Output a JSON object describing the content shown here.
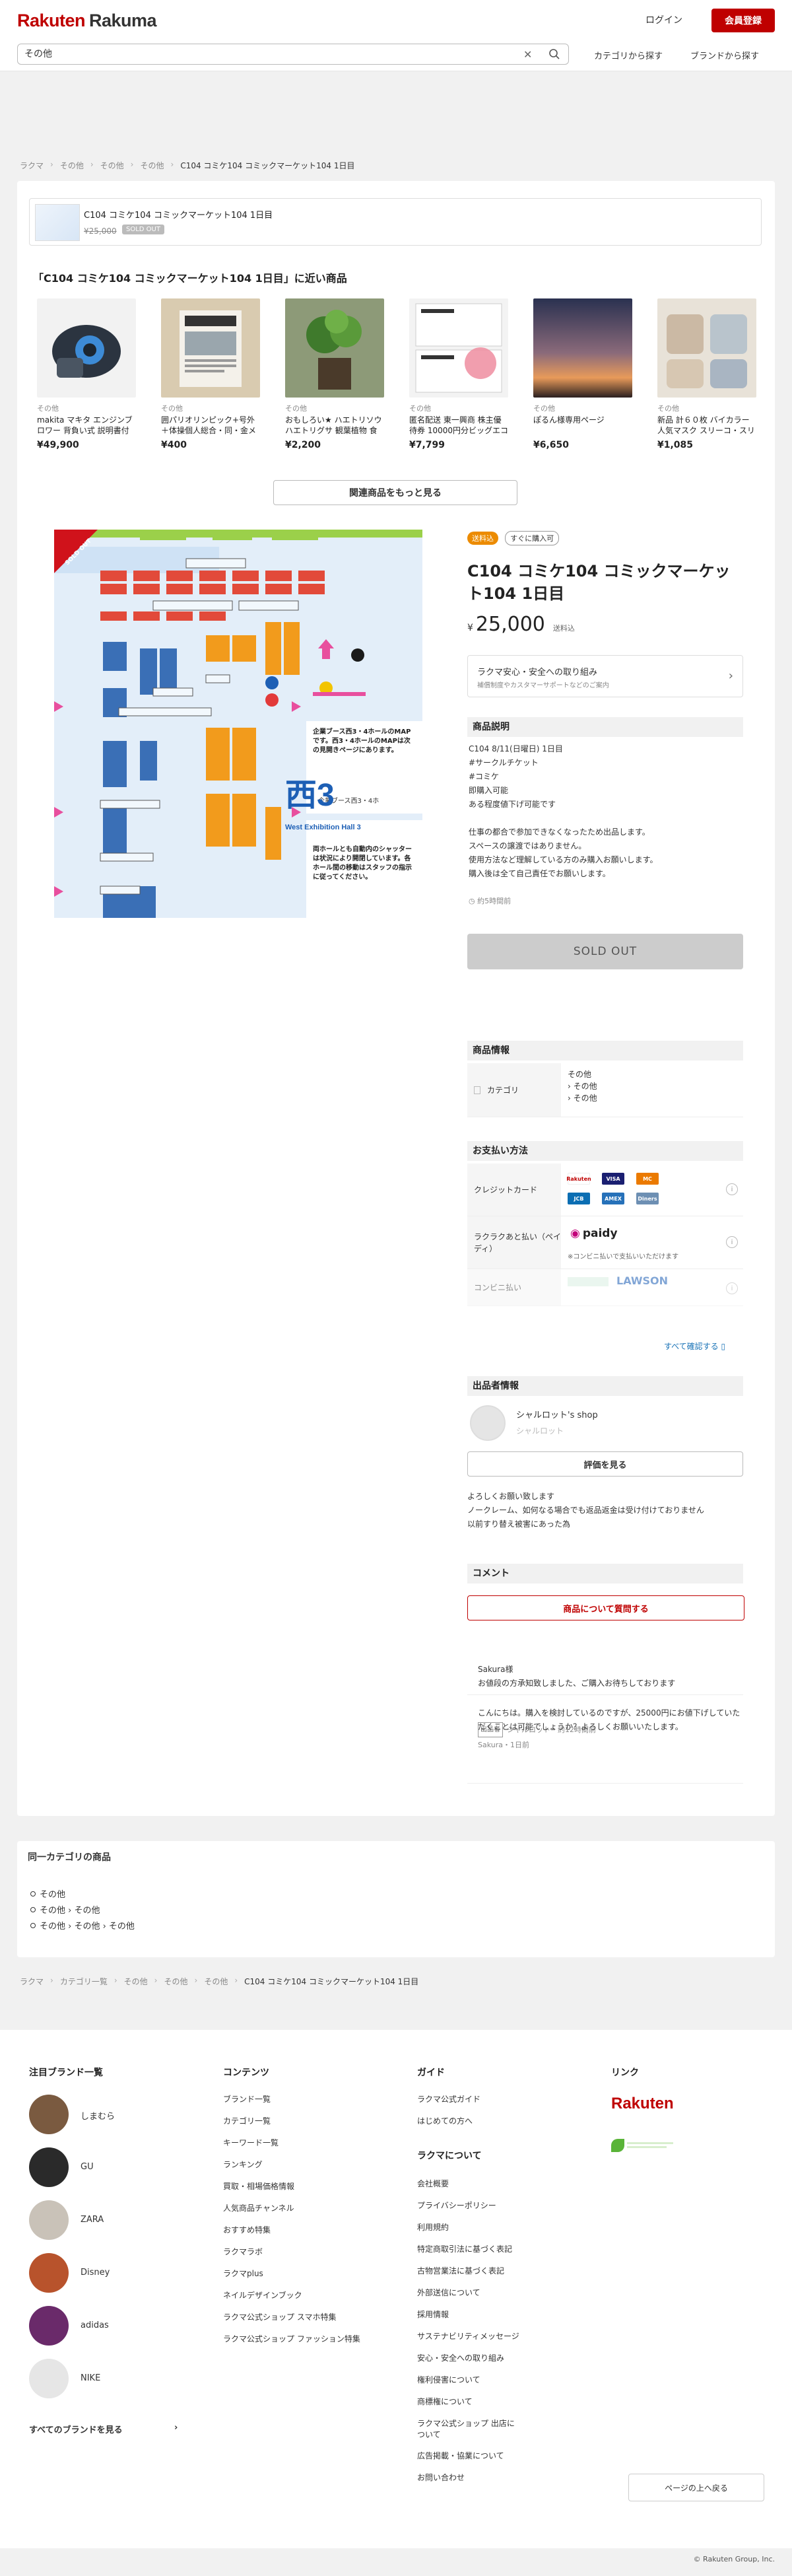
{
  "header": {
    "logo_a": "Rakuten",
    "logo_b": "Rakuma",
    "login": "ログイン",
    "signup": "会員登録",
    "search_value": "その他",
    "category_search": "カテゴリから探す",
    "brand_search": "ブランドから探す"
  },
  "breadcrumb_top": [
    "ラクマ",
    "その他",
    "その他",
    "その他",
    "C104 コミケ104 コミックマーケット104 1日目"
  ],
  "pinned": {
    "title": "C104 コミケ104 コミックマーケット104 1日目",
    "price": "¥25,000",
    "badge": "SOLD OUT"
  },
  "similar": {
    "title": "「C104 コミケ104 コミックマーケット104 1日目」に近い商品",
    "items": [
      {
        "cat": "その他",
        "name": "makita マキタ エンジンブロワー 背負い式 説明書付き 引取…",
        "price": "¥49,900"
      },
      {
        "cat": "その他",
        "name": "囲パリオリンピック+号外＋体操個人総合・同・金メダル囲",
        "price": "¥400"
      },
      {
        "cat": "その他",
        "name": "おもしろい★ ハエトリソウ ハエトリグサ 観葉植物 食虫植物",
        "price": "¥2,200"
      },
      {
        "cat": "その他",
        "name": "匿名配送 東一興商 株主優待券 10000円分ビッグエコー 1万円",
        "price": "¥7,799"
      },
      {
        "cat": "その他",
        "name": "ぽるん様専用ページ",
        "price": "¥6,650"
      },
      {
        "cat": "その他",
        "name": "新品 計６０枚 バイカラー 人気マスク スリーコ・スリーコインズ マ…",
        "price": "¥1,085"
      }
    ],
    "more": "関連商品をもっと見る"
  },
  "product": {
    "tag_shipping": "送料込",
    "tag_buynow": "すぐに購入可",
    "title": "C104 コミケ104 コミックマーケット104 1日目",
    "price_yen": "¥",
    "price": "25,000",
    "shipping": "送料込",
    "safe_title": "ラクマ安心・安全への取り組み",
    "safe_sub": "補償制度やカスタマーサポートなどのご案内",
    "desc_head": "商品説明",
    "description": "C104 8/11(日曜日) 1日目\n#サークルチケット\n#コミケ\n即購入可能\nある程度値下げ可能です\n\n仕事の都合で参加できなくなったため出品します。\nスペースの譲渡ではありません。\n使用方法など理解している方のみ購入お願いします。\n購入後は全て自己責任でお願いします。",
    "time": "約5時間前",
    "soldout": "SOLD OUT",
    "sold_badge": "SOLD OUT",
    "image_hall": "西3",
    "image_hall_sub": "West Exhibition Hall 3",
    "image_note1": "企業ブース西3・4ホールのMAPです。西3・4ホールのMAPは次の見開きページにあります。",
    "image_note2": "両ホールとも自動内のシャッターは状況により開閉しています。各ホール間の移動はスタッフの指示に従ってください。"
  },
  "info": {
    "head": "商品情報",
    "category_label": "カテゴリ",
    "category_values": [
      "その他",
      "› その他",
      "› その他"
    ]
  },
  "payment": {
    "head": "お支払い方法",
    "credit_label": "クレジットカード",
    "credit_logos": [
      "Rakuten",
      "VISA",
      "MC",
      "JCB",
      "AMEX",
      "Diners"
    ],
    "deferred_label": "ラクラクあと払い（ペイディ）",
    "paidy": "paidy",
    "paidy_note": "※コンビニ払いで支払いいただけます",
    "conv_label": "コンビニ払い",
    "conv_lawson": "LAWSON",
    "see_all": "すべて確認する"
  },
  "seller": {
    "head": "出品者情報",
    "name": "シャルロット's shop",
    "sub": "シャルロット",
    "review": "評価を見る",
    "message": "よろしくお願い致します\nノークレーム、如何なる場合でも返品返金は受け付けておりません\n以前すり替え被害にあった為"
  },
  "comments": {
    "head": "コメント",
    "ask": "商品について質問する",
    "items": [
      {
        "text": "Sakura様\nお値段の方承知致しました、ご購入お待ちしております",
        "seller_tag": "出品者",
        "meta": "シャルロット・約12時間前"
      },
      {
        "text": "こんにちは。購入を検討しているのですが、25000円にお値下げしていただくことは可能でしょうか？よろしくお願いいたします。",
        "meta": "Sakura・1日前"
      }
    ]
  },
  "same_category": {
    "title": "同一カテゴリの商品",
    "items": [
      "その他",
      "その他 › その他",
      "その他 › その他 › その他"
    ]
  },
  "breadcrumb_bottom": [
    "ラクマ",
    "カテゴリ一覧",
    "その他",
    "その他",
    "その他",
    "C104 コミケ104 コミックマーケット104 1日目"
  ],
  "footer": {
    "brands_title": "注目ブランド一覧",
    "brands": [
      "しまむら",
      "GU",
      "ZARA",
      "Disney",
      "adidas",
      "NIKE"
    ],
    "all_brands": "すべてのブランドを見る",
    "contents_title": "コンテンツ",
    "contents": [
      "ブランド一覧",
      "カテゴリ一覧",
      "キーワード一覧",
      "ランキング",
      "買取・相場価格情報",
      "人気商品チャンネル",
      "おすすめ特集",
      "ラクマラボ",
      "ラクマplus",
      "ネイルデザインブック",
      "ラクマ公式ショップ スマホ特集",
      "ラクマ公式ショップ ファッション特集"
    ],
    "guide_title": "ガイド",
    "guide": [
      "ラクマ公式ガイド",
      "はじめての方へ"
    ],
    "about_title": "ラクマについて",
    "about": [
      "会社概要",
      "プライバシーポリシー",
      "利用規約",
      "特定商取引法に基づく表記",
      "古物営業法に基づく表記",
      "外部送信について",
      "採用情報",
      "サステナビリティメッセージ",
      "安心・安全への取り組み",
      "権利侵害について",
      "商標権について",
      "ラクマ公式ショップ 出店について",
      "広告掲載・協業について",
      "お問い合わせ"
    ],
    "links_title": "リンク",
    "rakuten": "Rakuten",
    "back_top": "ページの上へ戻る",
    "copyright": "© Rakuten Group, Inc."
  },
  "colors": {
    "brand": "#bf0000",
    "link": "#1a73b7",
    "orange": "#ec8b00"
  }
}
